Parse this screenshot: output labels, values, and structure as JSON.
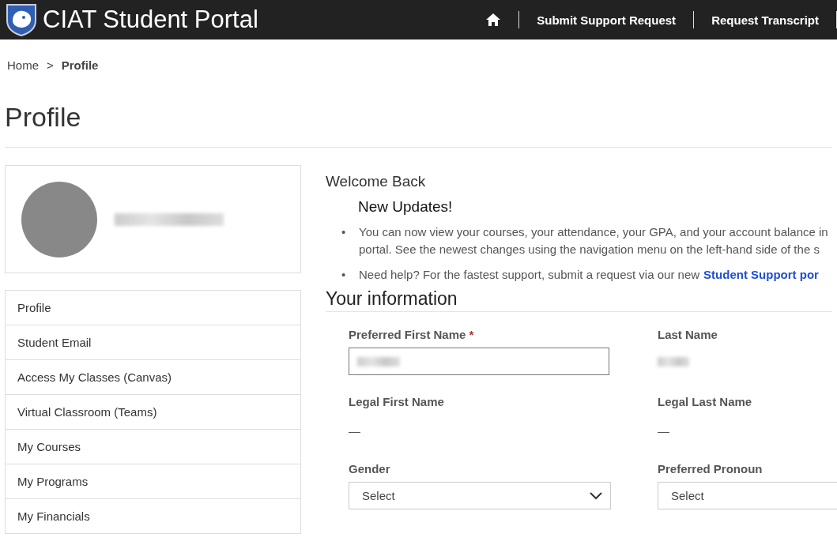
{
  "header": {
    "title": "CIAT Student Portal",
    "links": [
      "Submit Support Request",
      "Request Transcript"
    ]
  },
  "breadcrumb": {
    "items": [
      "Home"
    ],
    "separator": ">",
    "current": "Profile"
  },
  "page_title": "Profile",
  "sidebar": {
    "items": [
      {
        "label": "Profile"
      },
      {
        "label": "Student Email"
      },
      {
        "label": "Access My Classes (Canvas)"
      },
      {
        "label": "Virtual Classroom (Teams)"
      },
      {
        "label": "My Courses"
      },
      {
        "label": "My Programs"
      },
      {
        "label": "My Financials"
      }
    ]
  },
  "welcome": "Welcome Back",
  "updates": {
    "title": "New Updates!",
    "bullets": [
      {
        "marker": "•",
        "lines": [
          "You can now view your courses, your attendance, your GPA, and your account balance in",
          "portal. See the newest changes using the navigation menu on the left-hand side of the s"
        ]
      },
      {
        "marker": "•",
        "lines": [
          "Need help? For the fastest support, submit a request via our new"
        ],
        "link": "Student Support por"
      }
    ]
  },
  "info": {
    "title": "Your information",
    "fields": [
      {
        "label": "Preferred First Name",
        "required_mark": "*",
        "kind": "input"
      },
      {
        "label": "Last Name",
        "kind": "redacted"
      },
      {
        "label": "Legal First Name",
        "kind": "text",
        "value": "—"
      },
      {
        "label": "Legal Last Name",
        "kind": "text",
        "value": "—"
      },
      {
        "label": "Gender",
        "kind": "select",
        "value": "Select"
      },
      {
        "label": "Preferred Pronoun",
        "kind": "select_cut",
        "value": "Select"
      }
    ]
  }
}
